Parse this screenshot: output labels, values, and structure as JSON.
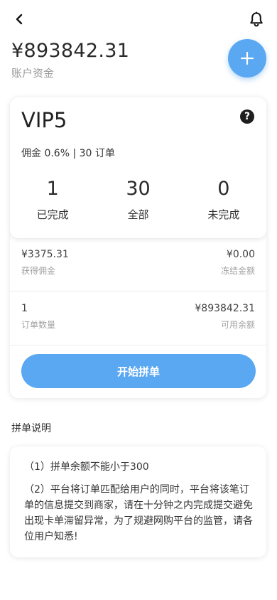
{
  "header": {
    "back_icon": "chevron-left-icon",
    "bell_icon": "bell-icon"
  },
  "account": {
    "balance": "¥893842.31",
    "balance_label": "账户资金",
    "add_icon": "plus-icon"
  },
  "vip": {
    "level": "VIP5",
    "help_icon": "question-circle-icon",
    "help_glyph": "?",
    "info": "佣金 0.6% | 30 订单",
    "stats": [
      {
        "value": "1",
        "label": "已完成"
      },
      {
        "value": "30",
        "label": "全部"
      },
      {
        "value": "0",
        "label": "未完成"
      }
    ]
  },
  "orders": {
    "commission_value": "¥3375.31",
    "commission_label": "获得佣金",
    "frozen_value": "¥0.00",
    "frozen_label": "冻结金额",
    "order_count_value": "1",
    "order_count_label": "订单数量",
    "available_value": "¥893842.31",
    "available_label": "可用余额",
    "start_button": "开始拼单"
  },
  "instructions": {
    "title": "拼单说明",
    "items": [
      "（1）拼单余额不能小于300",
      "（2）平台将订单匹配给用户的同时，平台将该笔订单的信息提交到商家，请在十分钟之内完成提交避免出现卡单滞留异常，为了规避网购平台的监管，请各位用户知悉!"
    ]
  },
  "colors": {
    "accent": "#5aa7f2",
    "text": "#222222",
    "muted": "#9a9a9a"
  }
}
